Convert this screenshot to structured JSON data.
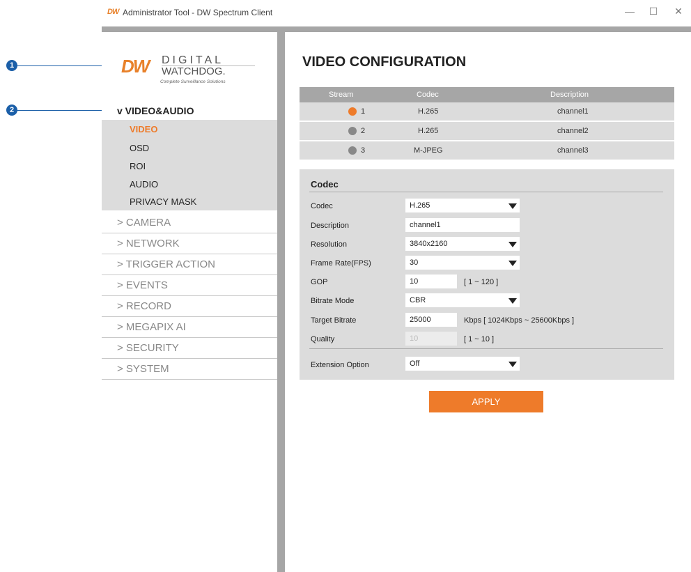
{
  "callouts": [
    "1",
    "2"
  ],
  "window": {
    "app_logo": "DW",
    "title": "Administrator Tool - DW Spectrum Client",
    "min_glyph": "—",
    "max_glyph": "☐",
    "close_glyph": "✕"
  },
  "brand": {
    "dw": "DW",
    "digital": "DIGITAL",
    "watchdog": "WATCHDOG.",
    "tagline": "Complete Surveillance Solutions",
    "accent": "#ee7b2a"
  },
  "sidebar": {
    "open_section": "v VIDEO&AUDIO",
    "sub_items": [
      "VIDEO",
      "OSD",
      "ROI",
      "AUDIO",
      "PRIVACY MASK"
    ],
    "items": [
      "> CAMERA",
      "> NETWORK",
      "> TRIGGER ACTION",
      "> EVENTS",
      "> RECORD",
      "> MEGAPIX AI",
      "> SECURITY",
      "> SYSTEM"
    ]
  },
  "main": {
    "title": "VIDEO CONFIGURATION",
    "stream_table": {
      "headers": [
        "Stream",
        "Codec",
        "Description"
      ],
      "rows": [
        {
          "stream": "1",
          "codec": "H.265",
          "description": "channel1",
          "selected": true
        },
        {
          "stream": "2",
          "codec": "H.265",
          "description": "channel2",
          "selected": false
        },
        {
          "stream": "3",
          "codec": "M-JPEG",
          "description": "channel3",
          "selected": false
        }
      ]
    },
    "codec_panel": {
      "title": "Codec",
      "codec_label": "Codec",
      "codec_value": "H.265",
      "description_label": "Description",
      "description_value": "channel1",
      "resolution_label": "Resolution",
      "resolution_value": "3840x2160",
      "framerate_label": "Frame Rate(FPS)",
      "framerate_value": "30",
      "gop_label": "GOP",
      "gop_value": "10",
      "gop_range": "[ 1 ~ 120 ]",
      "bitrate_mode_label": "Bitrate Mode",
      "bitrate_mode_value": "CBR",
      "target_bitrate_label": "Target Bitrate",
      "target_bitrate_value": "25000",
      "target_bitrate_range": "Kbps [ 1024Kbps ~ 25600Kbps ]",
      "quality_label": "Quality",
      "quality_value": "10",
      "quality_range": "[ 1 ~ 10 ]",
      "extension_label": "Extension Option",
      "extension_value": "Off"
    },
    "apply_label": "APPLY"
  }
}
